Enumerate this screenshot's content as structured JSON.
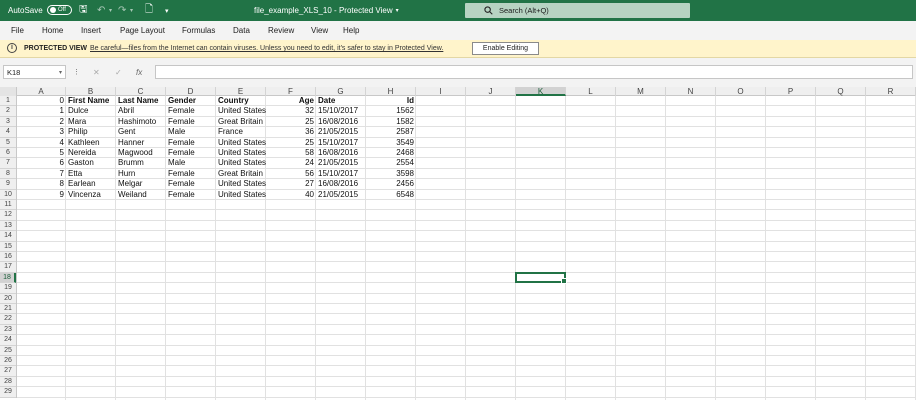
{
  "titlebar": {
    "autosave_label": "AutoSave",
    "autosave_state": "Off",
    "file_title": "file_example_XLS_10  -  Protected View",
    "search_placeholder": "Search (Alt+Q)"
  },
  "menu": [
    "File",
    "Home",
    "Insert",
    "Page Layout",
    "Formulas",
    "Data",
    "Review",
    "View",
    "Help"
  ],
  "banner": {
    "title": "PROTECTED VIEW",
    "message": "Be careful—files from the Internet can contain viruses. Unless you need to edit, it's safer to stay in Protected View.",
    "button": "Enable Editing"
  },
  "formula_bar": {
    "name_box": "K18",
    "fx": "fx",
    "value": ""
  },
  "sheet": {
    "columns": [
      "A",
      "B",
      "C",
      "D",
      "E",
      "F",
      "G",
      "H",
      "I",
      "J",
      "K",
      "L",
      "M",
      "N",
      "O",
      "P",
      "Q",
      "R"
    ],
    "selected_column": "K",
    "selected_row": 18,
    "row_count": 29,
    "header_row": [
      "0",
      "First Name",
      "Last Name",
      "Gender",
      "Country",
      "Age",
      "Date",
      "Id"
    ],
    "rows": [
      [
        "1",
        "Dulce",
        "Abril",
        "Female",
        "United States",
        "32",
        "15/10/2017",
        "1562"
      ],
      [
        "2",
        "Mara",
        "Hashimoto",
        "Female",
        "Great Britain",
        "25",
        "16/08/2016",
        "1582"
      ],
      [
        "3",
        "Philip",
        "Gent",
        "Male",
        "France",
        "36",
        "21/05/2015",
        "2587"
      ],
      [
        "4",
        "Kathleen",
        "Hanner",
        "Female",
        "United States",
        "25",
        "15/10/2017",
        "3549"
      ],
      [
        "5",
        "Nereida",
        "Magwood",
        "Female",
        "United States",
        "58",
        "16/08/2016",
        "2468"
      ],
      [
        "6",
        "Gaston",
        "Brumm",
        "Male",
        "United States",
        "24",
        "21/05/2015",
        "2554"
      ],
      [
        "7",
        "Etta",
        "Hurn",
        "Female",
        "Great Britain",
        "56",
        "15/10/2017",
        "3598"
      ],
      [
        "8",
        "Earlean",
        "Melgar",
        "Female",
        "United States",
        "27",
        "16/08/2016",
        "2456"
      ],
      [
        "9",
        "Vincenza",
        "Weiland",
        "Female",
        "United States",
        "40",
        "21/05/2015",
        "6548"
      ]
    ]
  },
  "colors": {
    "accent": "#217346",
    "banner_bg": "#fff4cb"
  }
}
